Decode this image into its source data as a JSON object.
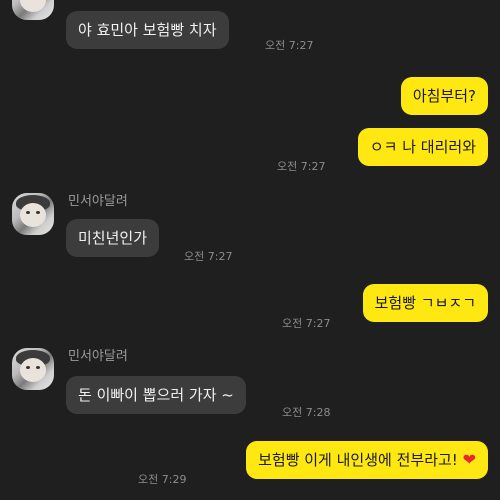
{
  "messages": [
    {
      "direction": "in",
      "text": "야 효민아 보험빵 치자",
      "time": "오전 7:27"
    },
    {
      "direction": "out",
      "text": "아침부터?"
    },
    {
      "direction": "out",
      "text": "ㅇㅋ 나 대리러와",
      "time": "오전 7:27"
    },
    {
      "direction": "in",
      "sender": "민서야달려",
      "text": "미친년인가",
      "time": "오전 7:27"
    },
    {
      "direction": "out",
      "text": "보험빵 ㄱㅂㅈㄱ",
      "time": "오전 7:27"
    },
    {
      "direction": "in",
      "sender": "민서야달려",
      "text": "돈 이빠이 뽑으러 가자 ~",
      "time": "오전 7:28"
    },
    {
      "direction": "out",
      "text": "보험빵 이게 내인생에 전부라고!",
      "emoji": "heart-emoji",
      "time": "오전 7:29"
    }
  ],
  "colors": {
    "background": "#1f1f1f",
    "incoming_bubble": "#3c3c3c",
    "outgoing_bubble": "#ffe812",
    "heart": "#e8262f"
  }
}
